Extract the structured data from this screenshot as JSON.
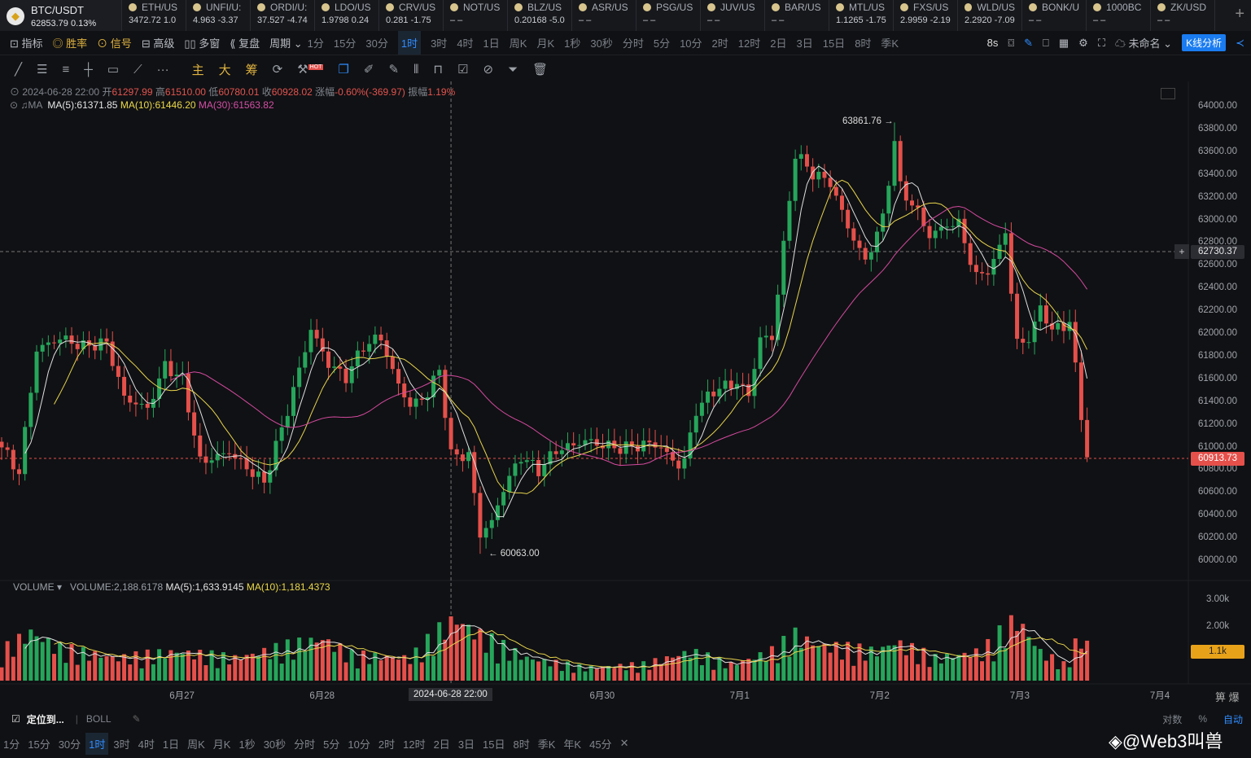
{
  "ticker": {
    "main": {
      "symbol": "BTC/USDT",
      "price": "62853.79",
      "change": "0.13%"
    },
    "items": [
      {
        "s": "ETH/US",
        "v": "3472.72 1.0"
      },
      {
        "s": "UNFI/U:",
        "v": "4.963 -3.37"
      },
      {
        "s": "ORDI/U:",
        "v": "37.527 -4.74"
      },
      {
        "s": "LDO/US",
        "v": "1.9798 0.24"
      },
      {
        "s": "CRV/US",
        "v": "0.281 -1.75"
      },
      {
        "s": "NOT/US",
        "v": "– –"
      },
      {
        "s": "BLZ/US",
        "v": "0.20168 -5.0"
      },
      {
        "s": "ASR/US",
        "v": "– –"
      },
      {
        "s": "PSG/US",
        "v": "– –"
      },
      {
        "s": "JUV/US",
        "v": "– –"
      },
      {
        "s": "BAR/US",
        "v": "– –"
      },
      {
        "s": "MTL/US",
        "v": "1.1265 -1.75"
      },
      {
        "s": "FXS/US",
        "v": "2.9959 -2.19"
      },
      {
        "s": "WLD/US",
        "v": "2.2920 -7.09"
      },
      {
        "s": "BONK/U",
        "v": "– –"
      },
      {
        "s": "1000BC",
        "v": "– –"
      },
      {
        "s": "ZK/USD",
        "v": "– –"
      }
    ]
  },
  "toolbar": {
    "indicator": "指标",
    "winrate": "胜率",
    "signal": "信号",
    "advanced": "高级",
    "multiwindow": "多窗",
    "replay": "复盘",
    "period": "周期",
    "periods": [
      "1分",
      "15分",
      "30分",
      "1时",
      "3时",
      "4时",
      "1日",
      "周K",
      "月K",
      "1秒",
      "30秒",
      "分时",
      "5分",
      "10分",
      "2时",
      "12时",
      "2日",
      "3日",
      "15日",
      "8时",
      "季K"
    ],
    "refresh": "8s",
    "layout_name": "未命名",
    "analysis": "K线分析"
  },
  "drawbar": {
    "main": "主",
    "big": "大",
    "chip": "筹",
    "hot": "HOT"
  },
  "ohlc": {
    "date": "2024-06-28 22:00",
    "open_label": "开",
    "open": "61297.99",
    "high_label": "高",
    "high": "61510.00",
    "low_label": "低",
    "low": "60780.01",
    "close_label": "收",
    "close": "60928.02",
    "chg_label": "涨幅",
    "chg": "-0.60%(-369.97)",
    "amp_label": "振幅",
    "amp": "1.19%"
  },
  "ma": {
    "label": "MA",
    "ma5": "MA(5):61371.85",
    "ma10": "MA(10):61446.20",
    "ma30": "MA(30):61563.82"
  },
  "volume": {
    "label": "VOLUME",
    "vol": "VOLUME:2,188.6178",
    "ma5": "MA(5):1,633.9145",
    "ma10": "MA(10):1,181.4373",
    "ticks": [
      "3.00k",
      "2.00k"
    ],
    "current": "1.1k"
  },
  "colors": {
    "up": "#26a65b",
    "down": "#e5504b",
    "ma5": "#e0e0e0",
    "ma10": "#e8d44d",
    "ma30": "#d54aa0",
    "accent": "#2f8cff"
  },
  "chart_data": {
    "type": "candlestick",
    "interval": "1h",
    "price_ticks": [
      "64000.00",
      "63800.00",
      "63600.00",
      "63400.00",
      "63200.00",
      "63000.00",
      "62800.00",
      "62600.00",
      "62400.00",
      "62200.00",
      "62000.00",
      "61800.00",
      "61600.00",
      "61400.00",
      "61200.00",
      "61000.00",
      "60800.00",
      "60600.00",
      "60400.00",
      "60200.00",
      "60000.00"
    ],
    "ylim": [
      60000,
      64000
    ],
    "x_ticks": [
      "6月27",
      "6月28",
      "6月30",
      "7月1",
      "7月2",
      "7月3",
      "7月4"
    ],
    "x_tick_hours": [
      31,
      55,
      103,
      127,
      151,
      175,
      199
    ],
    "crosshair": {
      "date": "2024-06-28 22:00",
      "price": "62730.37",
      "hour": 77
    },
    "current_price": "60913.73",
    "high_annotation": "63861.76",
    "low_annotation": "60063.00",
    "close_keypoints": [
      [
        0,
        61000
      ],
      [
        3,
        60800
      ],
      [
        6,
        61900
      ],
      [
        10,
        62000
      ],
      [
        14,
        61900
      ],
      [
        18,
        61900
      ],
      [
        21,
        61400
      ],
      [
        25,
        61300
      ],
      [
        28,
        61700
      ],
      [
        31,
        61600
      ],
      [
        34,
        60900
      ],
      [
        39,
        61000
      ],
      [
        45,
        60700
      ],
      [
        49,
        61300
      ],
      [
        53,
        62000
      ],
      [
        56,
        61700
      ],
      [
        59,
        61600
      ],
      [
        62,
        61900
      ],
      [
        65,
        62000
      ],
      [
        67,
        61700
      ],
      [
        70,
        61400
      ],
      [
        73,
        61500
      ],
      [
        75,
        61700
      ],
      [
        77,
        60928
      ],
      [
        80,
        60900
      ],
      [
        82,
        60200
      ],
      [
        84,
        60300
      ],
      [
        86,
        60600
      ],
      [
        89,
        60900
      ],
      [
        92,
        60800
      ],
      [
        95,
        61000
      ],
      [
        100,
        61100
      ],
      [
        106,
        61000
      ],
      [
        112,
        61000
      ],
      [
        116,
        60800
      ],
      [
        117,
        60850
      ],
      [
        119,
        61300
      ],
      [
        122,
        61500
      ],
      [
        126,
        61600
      ],
      [
        128,
        61500
      ],
      [
        130,
        62000
      ],
      [
        132,
        62000
      ],
      [
        134,
        62800
      ],
      [
        136,
        63600
      ],
      [
        139,
        63400
      ],
      [
        142,
        63300
      ],
      [
        145,
        62900
      ],
      [
        148,
        62600
      ],
      [
        151,
        63000
      ],
      [
        153,
        63700
      ],
      [
        154,
        63300
      ],
      [
        157,
        63100
      ],
      [
        159,
        62900
      ],
      [
        162,
        63000
      ],
      [
        164,
        63000
      ],
      [
        167,
        62500
      ],
      [
        170,
        62600
      ],
      [
        172,
        62900
      ],
      [
        173,
        62300
      ],
      [
        174,
        61900
      ],
      [
        176,
        61900
      ],
      [
        178,
        62200
      ],
      [
        180,
        62000
      ],
      [
        183,
        62100
      ],
      [
        185,
        61300
      ],
      [
        186,
        60913
      ]
    ],
    "volume_keypoints": [
      [
        0,
        900
      ],
      [
        5,
        1500
      ],
      [
        10,
        1000
      ],
      [
        20,
        700
      ],
      [
        30,
        900
      ],
      [
        40,
        700
      ],
      [
        50,
        1100
      ],
      [
        55,
        1300
      ],
      [
        60,
        800
      ],
      [
        70,
        700
      ],
      [
        76,
        1700
      ],
      [
        78,
        1900
      ],
      [
        82,
        1400
      ],
      [
        90,
        700
      ],
      [
        100,
        400
      ],
      [
        110,
        500
      ],
      [
        118,
        900
      ],
      [
        125,
        500
      ],
      [
        132,
        900
      ],
      [
        136,
        1400
      ],
      [
        140,
        1100
      ],
      [
        150,
        900
      ],
      [
        153,
        1200
      ],
      [
        160,
        700
      ],
      [
        168,
        900
      ],
      [
        172,
        1600
      ],
      [
        174,
        1900
      ],
      [
        178,
        900
      ],
      [
        182,
        500
      ],
      [
        185,
        1400
      ],
      [
        186,
        1100
      ]
    ]
  },
  "bottom": {
    "locate": "定位到...",
    "boll": "BOLL",
    "log": "对数",
    "pct": "%",
    "auto": "自动",
    "periods": [
      "1分",
      "15分",
      "30分",
      "1时",
      "3时",
      "4时",
      "1日",
      "周K",
      "月K",
      "1秒",
      "30秒",
      "分时",
      "5分",
      "10分",
      "2时",
      "12时",
      "2日",
      "3日",
      "15日",
      "8时",
      "季K",
      "年K",
      "45分"
    ],
    "watermark": "@Web3叫兽"
  }
}
